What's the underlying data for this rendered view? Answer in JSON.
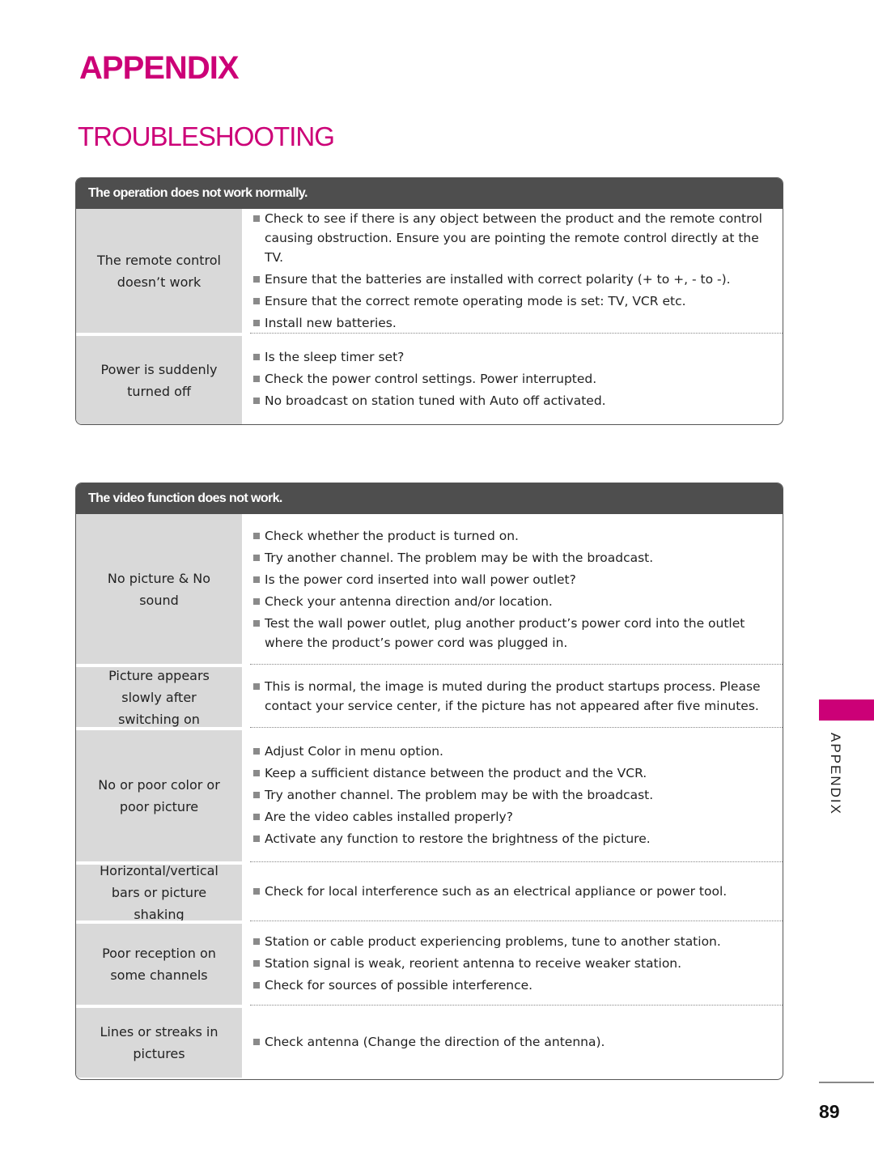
{
  "page": {
    "title": "APPENDIX",
    "subtitle": "TROUBLESHOOTING",
    "side_tab_label": "APPENDIX",
    "page_number": "89",
    "accent_color": "#cc0077"
  },
  "tables": [
    {
      "header": "The operation does not work normally.",
      "rows": [
        {
          "problem": "The remote control doesn’t work",
          "solutions": [
            "Check to see if there is any object between the product and the remote control causing obstruction. Ensure you are pointing the remote control directly at the TV.",
            "Ensure that the batteries are installed with correct polarity (+ to +, - to -).",
            "Ensure that the correct remote operating mode is set: TV, VCR etc.",
            "Install new batteries."
          ]
        },
        {
          "problem": "Power is suddenly turned off",
          "solutions": [
            "Is the sleep timer set?",
            "Check the power control settings. Power interrupted.",
            "No broadcast on station tuned with Auto off activated."
          ]
        }
      ]
    },
    {
      "header": "The video function does not work.",
      "rows": [
        {
          "problem": "No picture & No sound",
          "solutions": [
            "Check whether the product is turned on.",
            "Try another channel. The problem may be with the broadcast.",
            "Is the power cord inserted into wall power outlet?",
            "Check your antenna direction and/or location.",
            "Test the wall power outlet, plug another product’s power cord into the outlet where the product’s power cord was plugged in."
          ]
        },
        {
          "problem": "Picture appears slowly after switching on",
          "solutions": [
            "This is normal, the image is muted during the product startups process. Please contact your service center, if the picture has not appeared after five minutes."
          ]
        },
        {
          "problem": "No or poor color or poor picture",
          "solutions": [
            "Adjust Color in menu option.",
            "Keep a sufficient distance between the product and the VCR.",
            "Try another channel. The problem may be with the broadcast.",
            "Are the video cables installed properly?",
            "Activate any function to restore the brightness of the picture."
          ]
        },
        {
          "problem": "Horizontal/vertical bars or picture shaking",
          "solutions": [
            "Check for local interference such as an electrical appliance or power tool."
          ]
        },
        {
          "problem": "Poor reception on some channels",
          "solutions": [
            "Station or cable product experiencing problems, tune to another station.",
            "Station signal is weak, reorient antenna to receive weaker station.",
            "Check for sources of possible interference."
          ]
        },
        {
          "problem": "Lines or streaks in pictures",
          "solutions": [
            "Check antenna (Change the direction of the antenna)."
          ]
        }
      ]
    }
  ]
}
